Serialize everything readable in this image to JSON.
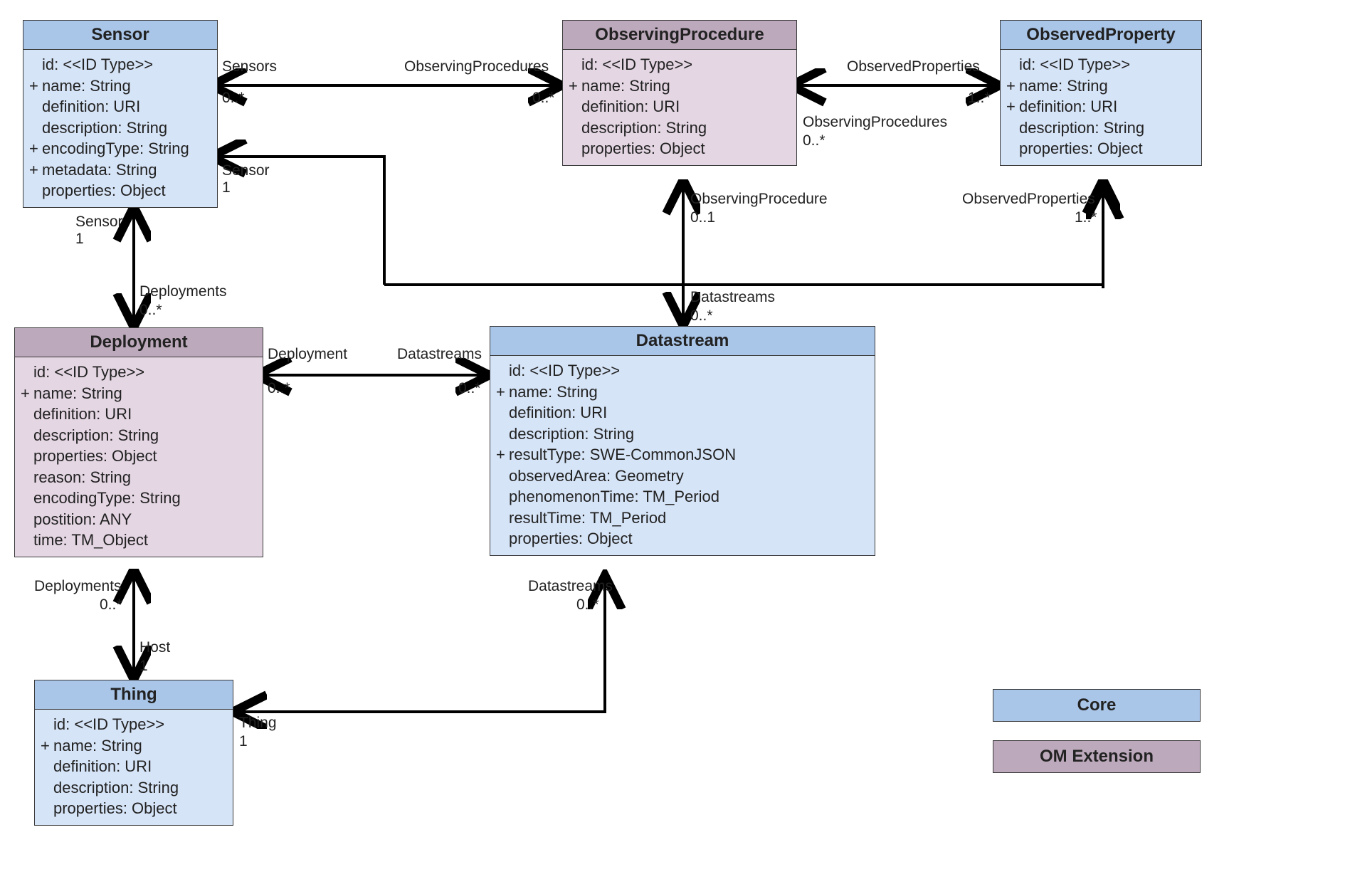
{
  "classes": {
    "sensor": {
      "title": "Sensor",
      "type": "core",
      "attrs": [
        {
          "v": "",
          "t": "id: <<ID Type>>"
        },
        {
          "v": "+",
          "t": "name: String"
        },
        {
          "v": "",
          "t": "definition: URI"
        },
        {
          "v": "",
          "t": "description: String"
        },
        {
          "v": "+",
          "t": "encodingType: String"
        },
        {
          "v": "+",
          "t": "metadata: String"
        },
        {
          "v": "",
          "t": "properties: Object"
        }
      ]
    },
    "observingProcedure": {
      "title": "ObservingProcedure",
      "type": "om",
      "attrs": [
        {
          "v": "",
          "t": "id: <<ID Type>>"
        },
        {
          "v": "+",
          "t": "name: String"
        },
        {
          "v": "",
          "t": "definition: URI"
        },
        {
          "v": "",
          "t": "description: String"
        },
        {
          "v": "",
          "t": "properties: Object"
        }
      ]
    },
    "observedProperty": {
      "title": "ObservedProperty",
      "type": "core",
      "attrs": [
        {
          "v": "",
          "t": "id: <<ID Type>>"
        },
        {
          "v": "+",
          "t": "name: String"
        },
        {
          "v": "+",
          "t": "definition: URI"
        },
        {
          "v": "",
          "t": "description: String"
        },
        {
          "v": "",
          "t": "properties: Object"
        }
      ]
    },
    "deployment": {
      "title": "Deployment",
      "type": "om",
      "attrs": [
        {
          "v": "",
          "t": "id: <<ID Type>>"
        },
        {
          "v": "+",
          "t": "name: String"
        },
        {
          "v": "",
          "t": "definition: URI"
        },
        {
          "v": "",
          "t": "description: String"
        },
        {
          "v": "",
          "t": "properties: Object"
        },
        {
          "v": "",
          "t": "reason: String"
        },
        {
          "v": "",
          "t": "encodingType: String"
        },
        {
          "v": "",
          "t": "postition: ANY"
        },
        {
          "v": "",
          "t": "time: TM_Object"
        }
      ]
    },
    "datastream": {
      "title": "Datastream",
      "type": "core",
      "attrs": [
        {
          "v": "",
          "t": "id: <<ID Type>>"
        },
        {
          "v": "+",
          "t": "name: String"
        },
        {
          "v": "",
          "t": "definition: URI"
        },
        {
          "v": "",
          "t": "description: String"
        },
        {
          "v": "+",
          "t": "resultType: SWE-CommonJSON"
        },
        {
          "v": "",
          "t": "observedArea: Geometry"
        },
        {
          "v": "",
          "t": "phenomenonTime: TM_Period"
        },
        {
          "v": "",
          "t": "resultTime: TM_Period"
        },
        {
          "v": "",
          "t": "properties: Object"
        }
      ]
    },
    "thing": {
      "title": "Thing",
      "type": "core",
      "attrs": [
        {
          "v": "",
          "t": "id: <<ID Type>>"
        },
        {
          "v": "+",
          "t": "name: String"
        },
        {
          "v": "",
          "t": "definition: URI"
        },
        {
          "v": "",
          "t": "description: String"
        },
        {
          "v": "",
          "t": "properties: Object"
        }
      ]
    }
  },
  "legend": {
    "core": "Core",
    "om": "OM Extension"
  },
  "edgeLabels": {
    "sensor_op_left_role": "Sensors",
    "sensor_op_left_mult": "0..*",
    "sensor_op_right_role": "ObservingProcedures",
    "sensor_op_right_mult": "0..*",
    "op_obsprop_left_role": "ObservedProperties",
    "op_obsprop_left_mult": "1..*",
    "op_obsprop_right_role": "ObservingProcedures",
    "op_obsprop_right_mult": "0..*",
    "sensor_depl_top_role": "Sensor",
    "sensor_depl_top_mult": "1",
    "sensor_depl_bot_role": "Deployments",
    "sensor_depl_bot_mult": "0..*",
    "depl_ds_left_role": "Deployment",
    "depl_ds_left_mult": "0..*",
    "depl_ds_right_role": "Datastreams",
    "depl_ds_right_mult": "0..*",
    "sensor_ds_role": "Sensor",
    "sensor_ds_mult": "1",
    "op_ds_role": "ObservingProcedure",
    "op_ds_mult": "0..1",
    "ds_bot_role": "Datastreams",
    "ds_bot_mult": "0..*",
    "obsprop_ds_role": "ObservedProperties",
    "obsprop_ds_mult": "1..*",
    "depl_thing_top_role": "Deployments",
    "depl_thing_top_mult": "0..*",
    "depl_thing_bot_role": "Host",
    "depl_thing_bot_mult": "1",
    "thing_ds_role": "Thing",
    "thing_ds_mult": "1",
    "ds_thing_role": "Datastreams",
    "ds_thing_mult": "0..*"
  }
}
